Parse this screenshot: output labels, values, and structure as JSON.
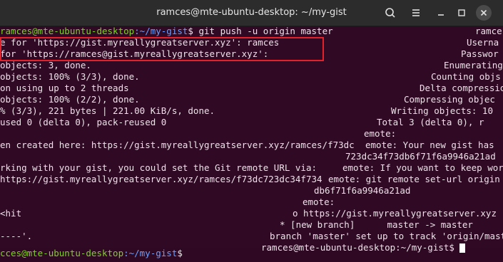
{
  "window": {
    "title": "ramces@mte-ubuntu-desktop: ~/my-gist"
  },
  "icons": {
    "search": "search-icon",
    "menu": "hamburger-menu-icon",
    "minimize": "minimize-icon",
    "maximize": "maximize-icon",
    "close": "close-icon"
  },
  "colors": {
    "background": "#300a24",
    "prompt_user": "#7ed321",
    "prompt_path": "#6aa0ff",
    "highlight": "#e2212a"
  },
  "left_lines": [
    {
      "user": "ramces@mte-ubuntu-desktop",
      "path": ":~/my-gist",
      "text": "$ git push -u origin master"
    },
    {
      "text": "e for 'https://gist.myreallygreatserver.xyz': ramces"
    },
    {
      "text": "for 'https://ramces@gist.myreallygreatserver.xyz':"
    },
    {
      "text": "objects: 3, done."
    },
    {
      "text": "objects: 100% (3/3), done."
    },
    {
      "text": "on using up to 2 threads"
    },
    {
      "text": "objects: 100% (2/2), done."
    },
    {
      "text": "% (3/3), 221 bytes | 221.00 KiB/s, done."
    },
    {
      "text": "used 0 (delta 0), pack-reused 0"
    },
    {
      "text": ""
    },
    {
      "text": "en created here: https://gist.myreallygreatserver.xyz/ramces/f73dc"
    },
    {
      "text": ""
    },
    {
      "text": "rking with your gist, you could set the Git remote URL via:"
    },
    {
      "text": "https://gist.myreallygreatserver.xyz/ramces/f73dc723dc34f734"
    },
    {
      "text": ""
    },
    {
      "text": ""
    },
    {
      "text": "<hit"
    },
    {
      "text": ""
    },
    {
      "text": ""
    },
    {
      "text": "----'."
    },
    {
      "user": "cces@mte-ubuntu-desktop",
      "path": ":~/my-gist",
      "text": "$"
    }
  ],
  "right_lines": [
    {
      "text": "ramce"
    },
    {
      "text": "Userna"
    },
    {
      "text": "Passwor"
    },
    {
      "text": "Enumerating"
    },
    {
      "text": "Counting objs"
    },
    {
      "text": "Delta compressio"
    },
    {
      "text": "Compressing objec"
    },
    {
      "text": "Writing objects: 10"
    },
    {
      "text": "Total 3 (delta 0), r"
    },
    {
      "text": "emote:"
    },
    {
      "text": "emote: Your new gist has"
    },
    {
      "text": "723dc34f73db6f71f6a9946a21ad"
    },
    {
      "text": "emote: If you want to keep wor"
    },
    {
      "text": "emote: git remote set-url origin"
    },
    {
      "text": "db6f71f6a9946a21ad"
    },
    {
      "text": "emote:"
    },
    {
      "text": "o https://gist.myreallygreatserver.xyz"
    },
    {
      "text": "* [new branch]      master -> master"
    },
    {
      "text": "branch 'master' set up to track 'origin/maste"
    },
    {
      "text": "ramces@mte-ubuntu-desktop:~/my-gist$"
    }
  ]
}
